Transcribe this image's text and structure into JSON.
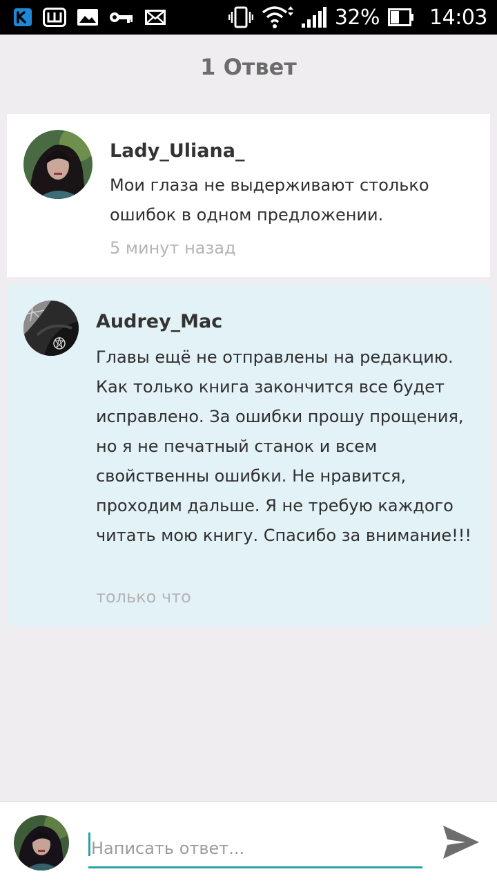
{
  "status_bar": {
    "left_icons": [
      "vk-icon",
      "w-app-icon",
      "image-icon",
      "key-icon",
      "mail-icon"
    ],
    "right_icons": [
      "vibrate-icon",
      "wifi-icon",
      "signal-icon",
      "battery-icon"
    ],
    "battery": "32%",
    "time": "14:03"
  },
  "header": {
    "title": "1 Ответ"
  },
  "comments": [
    {
      "author": "Lady_Uliana_",
      "text": "Мои глаза не выдерживают столько ошибок в одном предложении.",
      "time": "5 минут назад"
    },
    {
      "author": "Audrey_Mac",
      "text": "Главы ещё не отправлены на редакцию. Как только книга закончится все будет исправлено. За ошибки прошу прощения, но я не печатный станок и всем свойственны ошибки. Не нравится, проходим дальше. Я не требую каждого читать мою книгу. Спасибо за внимание!!!",
      "time": "только что"
    }
  ],
  "reply": {
    "placeholder": "Написать ответ...",
    "value": "",
    "send_icon": "send-icon"
  },
  "colors": {
    "background": "#efedef",
    "highlight_card": "#e3f2f7",
    "accent": "#2aa1a6",
    "status_bar": "#000000"
  }
}
